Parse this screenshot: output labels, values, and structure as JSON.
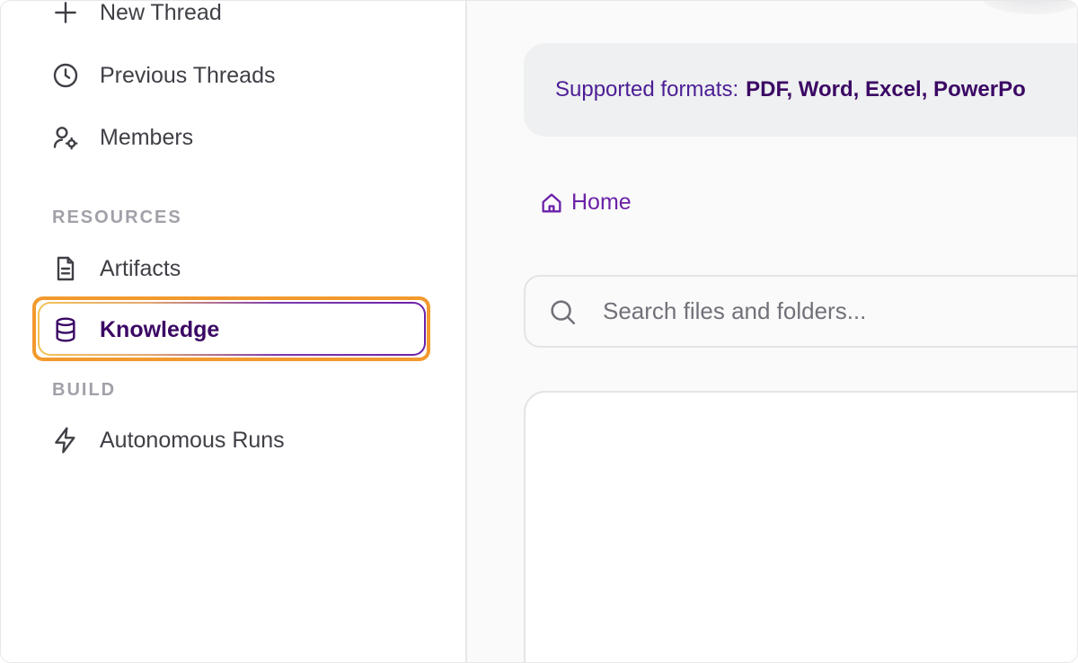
{
  "sidebar": {
    "items": [
      {
        "label": "New Thread",
        "icon": "plus-icon"
      },
      {
        "label": "Previous Threads",
        "icon": "clock-icon"
      },
      {
        "label": "Members",
        "icon": "members-icon"
      }
    ],
    "resources_label": "RESOURCES",
    "resources": [
      {
        "label": "Artifacts",
        "icon": "document-icon"
      },
      {
        "label": "Knowledge",
        "icon": "database-icon",
        "active": true
      }
    ],
    "build_label": "BUILD",
    "build": [
      {
        "label": "Autonomous Runs",
        "icon": "lightning-icon"
      }
    ]
  },
  "main": {
    "banner": {
      "prefix": "Supported formats:",
      "formats": "PDF, Word, Excel, PowerPo"
    },
    "breadcrumb": {
      "home_label": "Home",
      "icon": "home-icon"
    },
    "search": {
      "placeholder": "Search files and folders...",
      "value": "",
      "icon": "search-icon"
    }
  },
  "colors": {
    "accent": "#6b21a8",
    "highlight_outline": "#f29a2e",
    "text_primary": "#3f3f46",
    "section_label": "#a1a1aa"
  }
}
